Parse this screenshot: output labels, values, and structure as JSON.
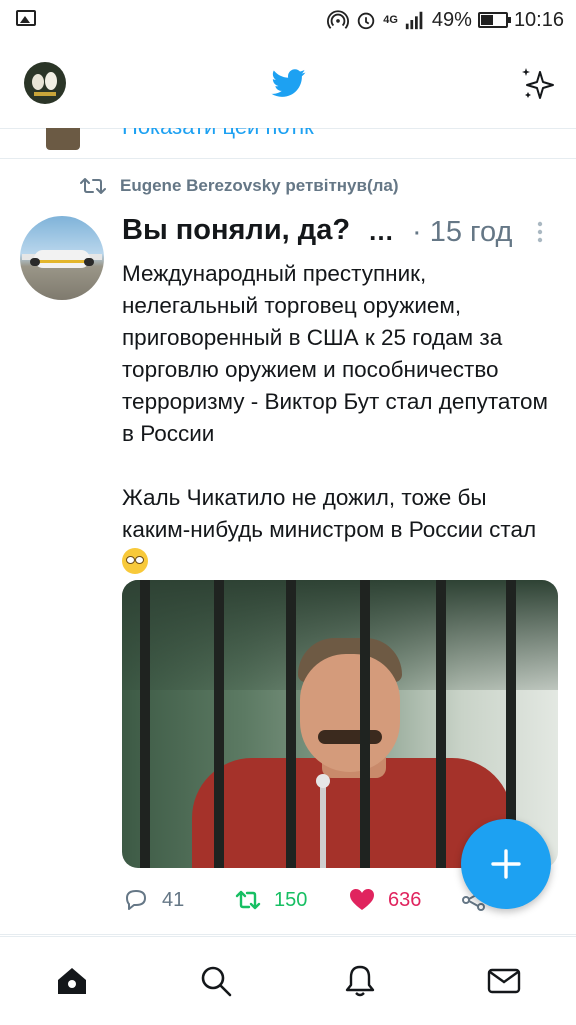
{
  "status_bar": {
    "network": "4G",
    "battery_percent_text": "49%",
    "battery_level": 0.49,
    "time": "10:16"
  },
  "header": {
    "logo_icon": "twitter-bird-icon",
    "sparkle_icon": "sparkle-icon",
    "brand_color": "#1da1f2"
  },
  "thread": {
    "link_text": "Показати цей потік"
  },
  "tweet": {
    "retweet_text": "Eugene Berezovsky ретвітнув(ла)",
    "author_name": "Вы поняли, да?",
    "author_ellipsis": "…",
    "time_sep": "·",
    "time": "15 год",
    "text": "Международный преступник, нелегальный торговец оружием, приговоренный в США к 25 годам за торговлю оружием и пособничество терроризму - Виктор Бут стал депутатом в России",
    "text2": "Жаль Чикатило не дожил, тоже бы каким-нибудь министром в России стал",
    "actions": {
      "replies": "41",
      "retweets": "150",
      "likes": "636"
    },
    "colors": {
      "retweet": "#17bf63",
      "like": "#e0245e",
      "muted": "#657786"
    }
  },
  "nav": {
    "items": [
      "home-icon",
      "search-icon",
      "notifications-icon",
      "messages-icon"
    ]
  }
}
